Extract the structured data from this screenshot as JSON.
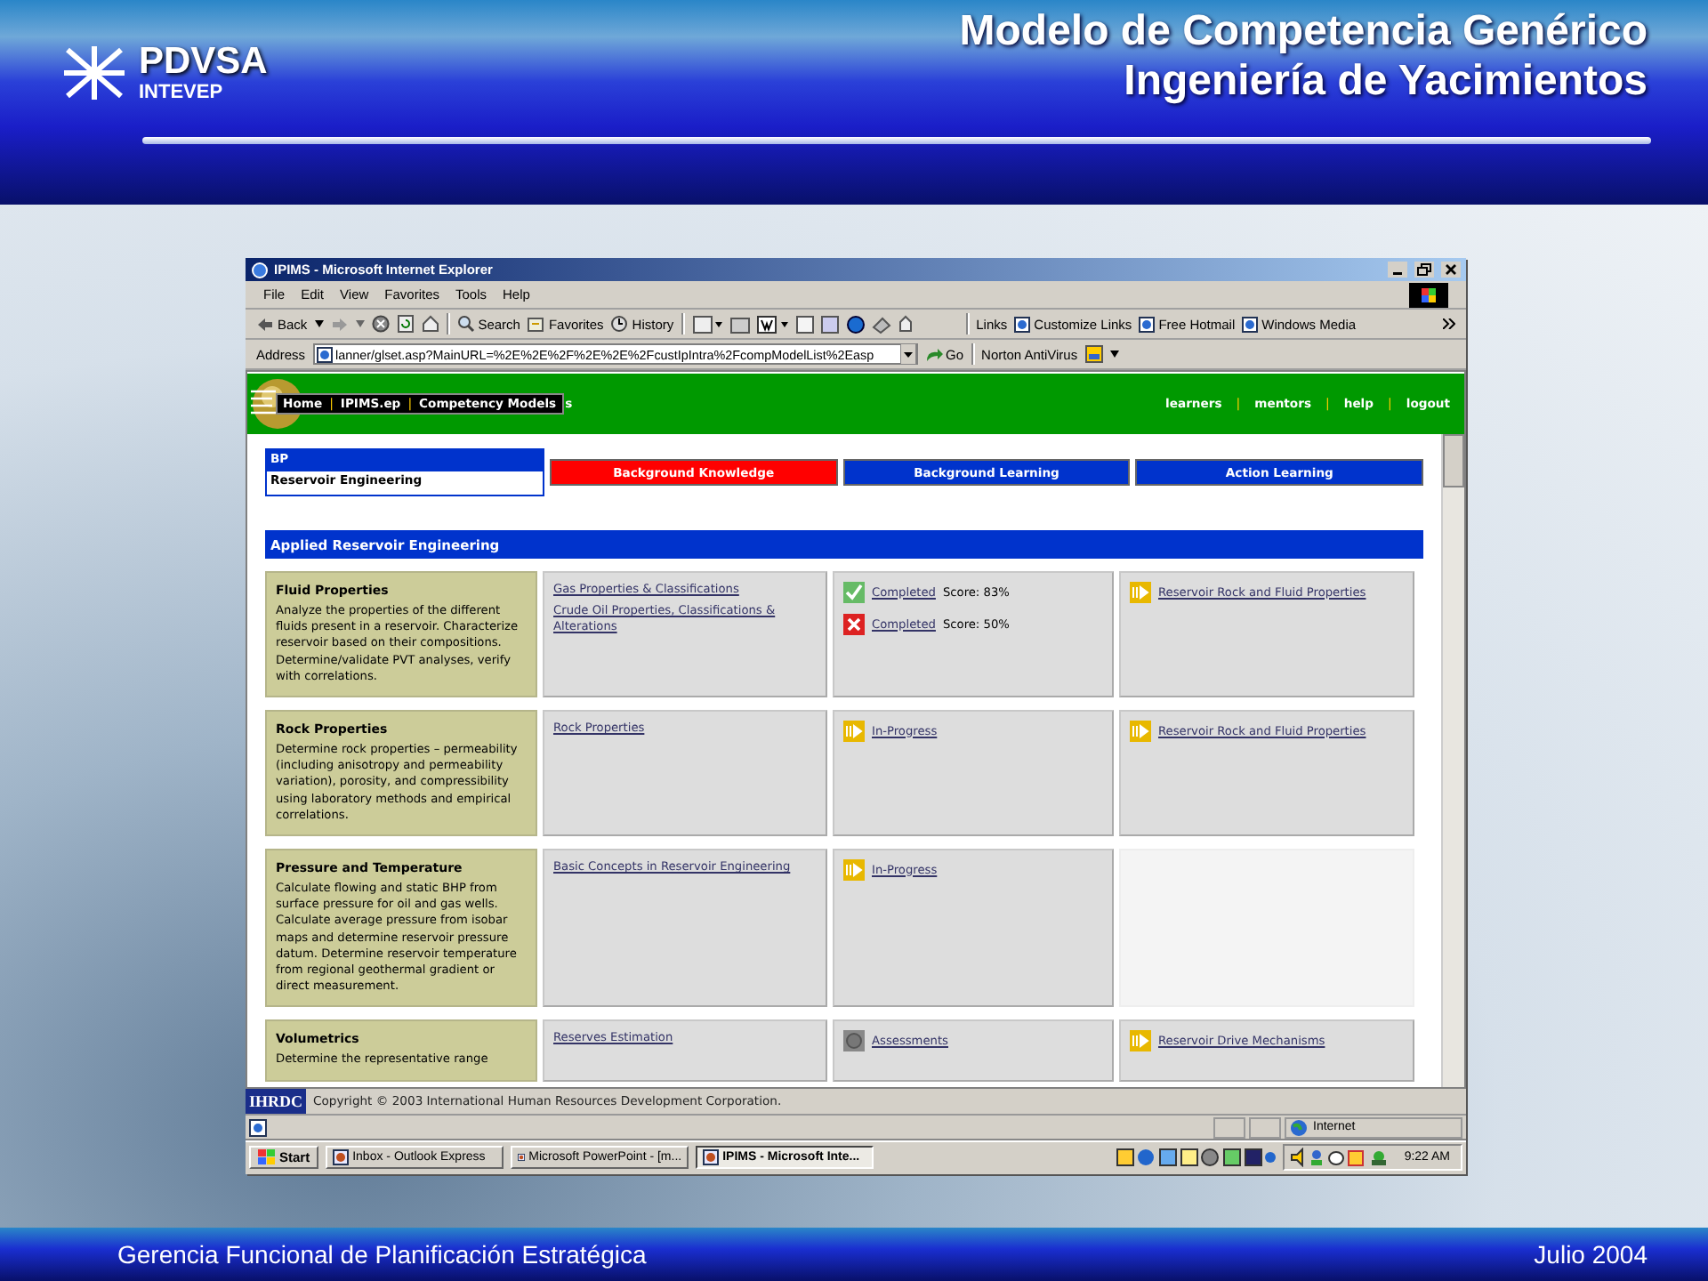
{
  "header": {
    "logo": {
      "name": "PDVSA",
      "subtitle": "INTEVEP"
    },
    "title_lines": [
      "Modelo de Competencia Genérico",
      "Ingeniería de Yacimientos"
    ]
  },
  "browser": {
    "title": "IPIMS - Microsoft Internet Explorer",
    "menu": [
      "File",
      "Edit",
      "View",
      "Favorites",
      "Tools",
      "Help"
    ],
    "toolbar": {
      "back": "Back",
      "search": "Search",
      "favorites": "Favorites",
      "history": "History",
      "links_label": "Links",
      "links": [
        "Customize Links",
        "Free Hotmail",
        "Windows Media"
      ]
    },
    "address": {
      "label": "Address",
      "value": "lanner/glset.asp?MainURL=%2E%2E%2F%2E%2E%2FcustIpIntra%2FcompModelList%2Easp",
      "go": "Go",
      "norton": "Norton AntiVirus"
    }
  },
  "site": {
    "nav_left": [
      {
        "kind": "link",
        "label": "Home"
      },
      {
        "kind": "separator",
        "label": "|"
      },
      {
        "kind": "link",
        "label": "IPIMS.ep"
      },
      {
        "kind": "separator",
        "label": "|"
      },
      {
        "kind": "link",
        "label": "Competency Models"
      }
    ],
    "nav_overflow": "s",
    "nav_right": [
      {
        "kind": "link",
        "label": "learners"
      },
      {
        "kind": "separator",
        "label": "|"
      },
      {
        "kind": "link",
        "label": "mentors"
      },
      {
        "kind": "separator",
        "label": "|"
      },
      {
        "kind": "link",
        "label": "help"
      },
      {
        "kind": "separator",
        "label": "|"
      },
      {
        "kind": "link",
        "label": "logout"
      }
    ],
    "context": {
      "company": "BP",
      "track": "Reservoir Engineering"
    },
    "tabs": [
      {
        "label": "Background Knowledge",
        "color": "#ff0000"
      },
      {
        "label": "Background Learning",
        "color": "#0033cc"
      },
      {
        "label": "Action Learning",
        "color": "#0033cc"
      }
    ],
    "section": "Applied Reservoir Engineering",
    "rows": [
      {
        "title": "Fluid Properties",
        "description": "Analyze the properties of the different fluids present in a reservoir. Characterize reservoir based on their compositions. Determine/validate PVT analyses, verify with correlations.",
        "resources": [
          "Gas Properties & Classifications",
          "Crude Oil Properties, Classifications & Alterations"
        ],
        "status": [
          {
            "kind": "passed",
            "label": "Completed",
            "score": "Score: 83%"
          },
          {
            "kind": "failed",
            "label": "Completed",
            "score": "Score: 50%"
          }
        ],
        "next": [
          {
            "kind": "in_progress",
            "label": "Reservoir Rock and Fluid Properties"
          }
        ]
      },
      {
        "title": "Rock Properties",
        "description": "Determine rock properties – permeability (including anisotropy and permeability variation), porosity, and compressibility using laboratory methods and empirical correlations.",
        "resources": [
          "Rock Properties"
        ],
        "status": [
          {
            "kind": "in_progress",
            "label": "In-Progress"
          }
        ],
        "next": [
          {
            "kind": "in_progress",
            "label": "Reservoir Rock and Fluid Properties"
          }
        ]
      },
      {
        "title": "Pressure and Temperature",
        "description": "Calculate flowing and static BHP from surface pressure for oil and gas wells. Calculate average pressure from isobar maps and determine reservoir pressure datum. Determine reservoir temperature from regional geothermal gradient or direct measurement.",
        "resources": [
          "Basic Concepts in Reservoir Engineering"
        ],
        "status": [
          {
            "kind": "in_progress",
            "label": "In-Progress"
          }
        ],
        "next": []
      },
      {
        "title": "Volumetrics",
        "description": "Determine the representative range",
        "resources": [
          "Reserves Estimation"
        ],
        "status": [
          {
            "kind": "assessment",
            "label": "Assessments"
          }
        ],
        "next": [
          {
            "kind": "in_progress",
            "label": "Reservoir Drive Mechanisms"
          }
        ]
      }
    ]
  },
  "copyright": {
    "logo": "IHRDC",
    "text": "Copyright © 2003 International Human Resources Development Corporation."
  },
  "status_bar": {
    "zone": "Internet"
  },
  "taskbar": {
    "start": "Start",
    "tasks": [
      {
        "label": "Inbox - Outlook Express",
        "selected": false
      },
      {
        "label": "Microsoft PowerPoint - [m...",
        "selected": false
      },
      {
        "label": "IPIMS - Microsoft Inte...",
        "selected": true
      }
    ],
    "clock": "9:22 AM"
  },
  "footer": {
    "left": "Gerencia Funcional de Planificación Estratégica",
    "right": "Julio 2004"
  }
}
